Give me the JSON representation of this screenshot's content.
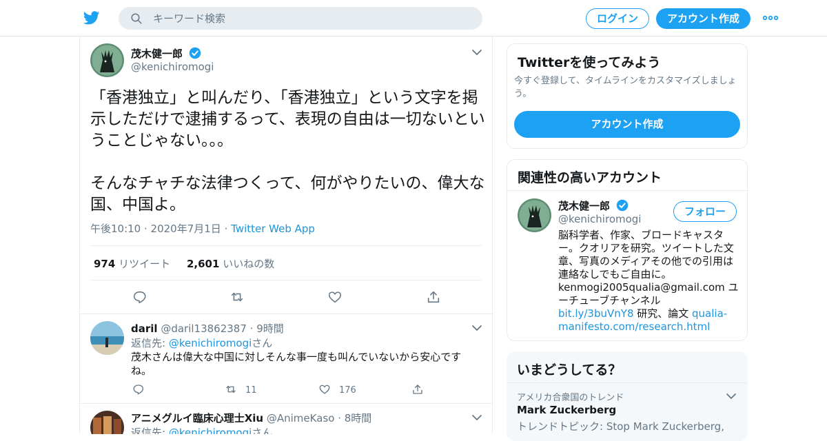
{
  "header": {
    "search_placeholder": "キーワード検索",
    "login_label": "ログイン",
    "signup_label": "アカウント作成",
    "brand_color": "#1da1f2"
  },
  "tweet": {
    "display_name": "茂木健一郎",
    "handle": "@kenichiromogi",
    "text": "「香港独立」と叫んだり、「香港独立」という文字を掲示しただけで逮捕するって、表現の自由は一切ないということじゃない。。。\n\nそんなチャチな法律つくって、何がやりたいの、偉大な国、中国よ。",
    "time": "午後10:10",
    "date": "2020年7月1日",
    "source": "Twitter Web App",
    "retweets": "974",
    "retweets_label": "リツイート",
    "likes": "2,601",
    "likes_label": "いいねの数"
  },
  "replies": [
    {
      "display_name": "daril",
      "handle": "@daril13862387",
      "age": "9時間",
      "replying_to_label": "返信先: ",
      "replying_to": "@kenichiromogi",
      "replying_to_suffix": "さん",
      "text": "茂木さんは偉大な中国に対しそんな事一度も叫んでいないから安心ですね。",
      "retweets": "11",
      "likes": "176"
    },
    {
      "display_name": "アニメグルイ臨床心理士Xiu",
      "handle": "@AnimeKaso",
      "age": "8時間",
      "replying_to_label": "返信先: ",
      "replying_to": "@kenichiromogi",
      "replying_to_suffix": "さん"
    }
  ],
  "signup_card": {
    "title": "Twitterを使ってみよう",
    "subtitle": "今すぐ登録して、タイムラインをカスタマイズしましょう。",
    "button_label": "アカウント作成"
  },
  "related_card": {
    "title": "関連性の高いアカウント",
    "display_name": "茂木健一郎",
    "handle": "@kenichiromogi",
    "follow_label": "フォロー",
    "bio_text": "脳科学者、作家、ブロードキャスター。クオリアを研究。ツイートした文章、写真のメディアその他での引用は連絡なしでもご自由に。kenmogi2005qualia@gmail.com ユーチューブチャンネル ",
    "bio_link1": "bit.ly/3buVnY8",
    "bio_mid": " 研究、論文 ",
    "bio_link2": "qualia-manifesto.com/research.html"
  },
  "trends_card": {
    "title": "いまどうしてる？",
    "context": "アメリカ合衆国のトレンド",
    "trend_name": "Mark Zuckerberg",
    "trend_topic": "トレンドトピック: Stop Mark Zuckerberg,"
  }
}
